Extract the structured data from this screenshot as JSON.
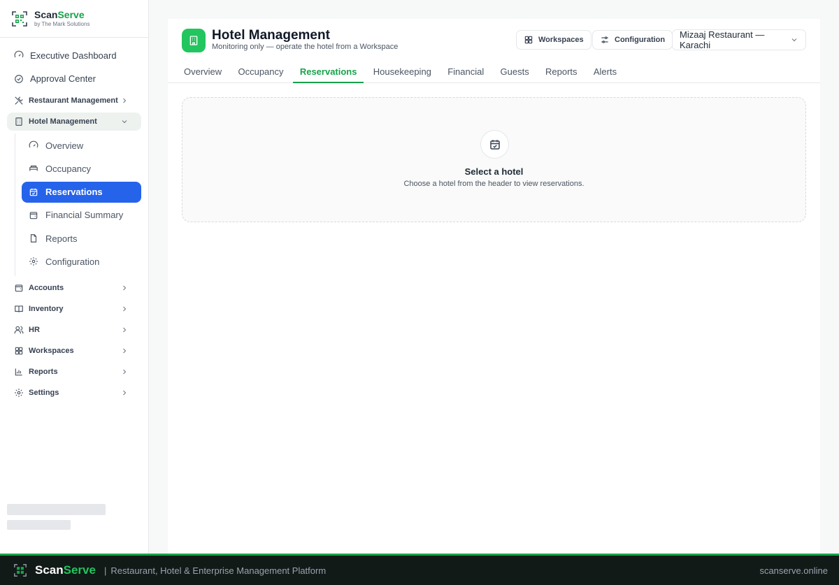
{
  "brand": {
    "name_part1": "Scan",
    "name_part2": "Serve",
    "subtitle": "by The Mark Solutions"
  },
  "sidebar": {
    "top_items": [
      {
        "label": "Executive Dashboard",
        "icon": "gauge-icon"
      },
      {
        "label": "Approval Center",
        "icon": "check-circle-icon"
      }
    ],
    "groups": [
      {
        "label": "Restaurant Management",
        "icon": "utensils-icon",
        "expanded": false
      },
      {
        "label": "Hotel Management",
        "icon": "building-icon",
        "expanded": true
      }
    ],
    "hotel_items": [
      {
        "label": "Overview",
        "icon": "gauge-icon"
      },
      {
        "label": "Occupancy",
        "icon": "bed-icon"
      },
      {
        "label": "Reservations",
        "icon": "calendar-check-icon",
        "active": true
      },
      {
        "label": "Financial Summary",
        "icon": "wallet-icon"
      },
      {
        "label": "Reports",
        "icon": "file-icon"
      },
      {
        "label": "Configuration",
        "icon": "gear-icon"
      }
    ],
    "lower_groups": [
      {
        "label": "Accounts",
        "icon": "wallet-icon"
      },
      {
        "label": "Inventory",
        "icon": "book-icon"
      },
      {
        "label": "HR",
        "icon": "users-icon"
      },
      {
        "label": "Workspaces",
        "icon": "grid-icon"
      },
      {
        "label": "Reports",
        "icon": "bar-chart-icon"
      },
      {
        "label": "Settings",
        "icon": "gear-icon"
      }
    ]
  },
  "header": {
    "title": "Hotel Management",
    "subtitle": "Monitoring only — operate the hotel from a Workspace",
    "workspaces_button": "Workspaces",
    "configuration_button": "Configuration",
    "selected_outlet": "Mizaaj Restaurant — Karachi"
  },
  "tabs": [
    "Overview",
    "Occupancy",
    "Reservations",
    "Housekeeping",
    "Financial",
    "Guests",
    "Reports",
    "Alerts"
  ],
  "active_tab": "Reservations",
  "empty_state": {
    "title": "Select a hotel",
    "message": "Choose a hotel from the header to view reservations."
  },
  "footer": {
    "brand_part1": "Scan",
    "brand_part2": "Serve",
    "separator": "|",
    "tagline": "Restaurant, Hotel & Enterprise Management Platform",
    "url": "scanserve.online"
  },
  "colors": {
    "accent": "#16a34a",
    "active_blue": "#2563eb",
    "footer_bg": "#111a17"
  }
}
